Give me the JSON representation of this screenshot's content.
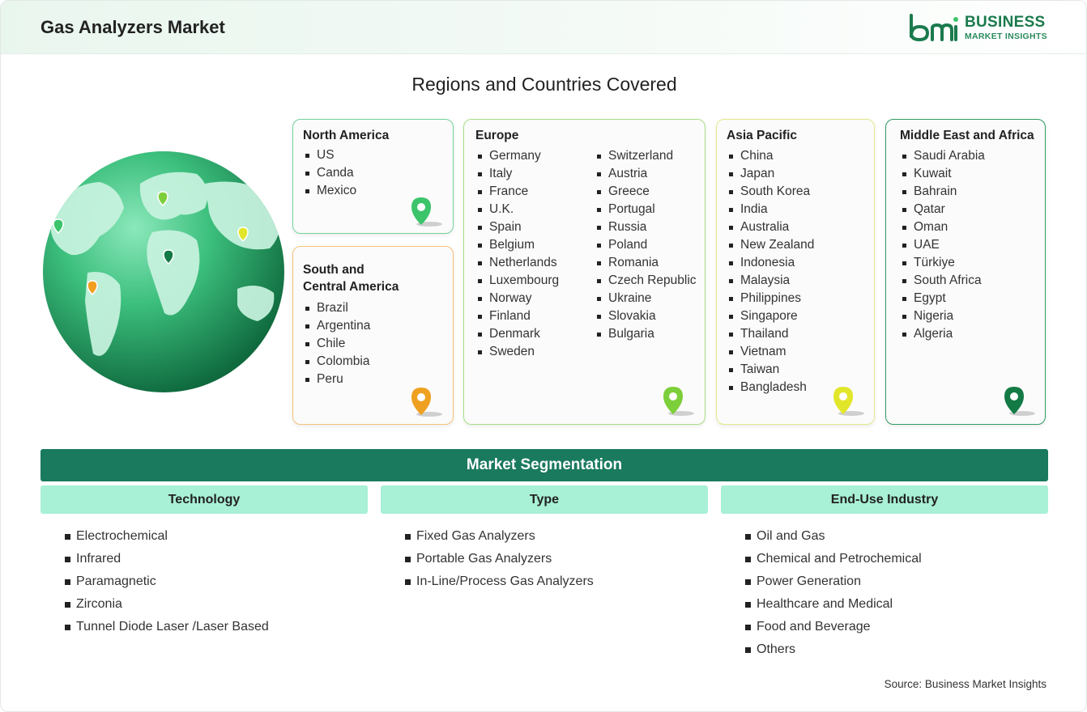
{
  "header": {
    "title": "Gas Analyzers Market"
  },
  "logo": {
    "line1": "BUSINESS",
    "line2": "MARKET INSIGHTS",
    "color": "#1b7a4d"
  },
  "regions_title": "Regions and Countries Covered",
  "regions": {
    "north_america": {
      "title": "North America",
      "items": [
        "US",
        "Canda",
        "Mexico"
      ],
      "pin_color": "#3cc46b"
    },
    "south_central_america": {
      "title_line1": "South and",
      "title_line2": "Central America",
      "items": [
        "Brazil",
        "Argentina",
        "Chile",
        "Colombia",
        "Peru"
      ],
      "pin_color": "#f0a020"
    },
    "europe": {
      "title": "Europe",
      "col1": [
        "Germany",
        "Italy",
        "France",
        "U.K.",
        "Spain",
        "Belgium",
        "Netherlands",
        "Luxembourg",
        "Norway",
        "Finland",
        "Denmark",
        "Sweden"
      ],
      "col2": [
        "Switzerland",
        "Austria",
        "Greece",
        "Portugal",
        "Russia",
        "Poland",
        "Romania",
        "Czech Republic",
        "Ukraine",
        "Slovakia",
        "Bulgaria"
      ],
      "pin_color": "#7ccf3a"
    },
    "asia_pacific": {
      "title": "Asia Pacific",
      "items": [
        "China",
        "Japan",
        "South Korea",
        "India",
        "Australia",
        "New Zealand",
        "Indonesia",
        "Malaysia",
        "Philippines",
        "Singapore",
        "Thailand",
        "Vietnam",
        "Taiwan",
        "Bangladesh"
      ],
      "pin_color": "#e2e62a"
    },
    "mea": {
      "title": "Middle East and Africa",
      "items": [
        "Saudi Arabia",
        "Kuwait",
        "Bahrain",
        "Qatar",
        "Oman",
        "UAE",
        "Türkiye",
        "South Africa",
        "Egypt",
        "Nigeria",
        "Algeria"
      ],
      "pin_color": "#137a45"
    }
  },
  "segmentation": {
    "title": "Market Segmentation",
    "columns": [
      {
        "header": "Technology",
        "items": [
          "Electrochemical",
          "Infrared",
          "Paramagnetic",
          "Zirconia",
          "Tunnel Diode Laser /Laser Based"
        ]
      },
      {
        "header": "Type",
        "items": [
          "Fixed Gas Analyzers",
          "Portable Gas Analyzers",
          "In-Line/Process Gas Analyzers"
        ]
      },
      {
        "header": "End-Use Industry",
        "items": [
          "Oil and Gas",
          "Chemical and Petrochemical",
          "Power Generation",
          "Healthcare and Medical",
          "Food and Beverage",
          "Others"
        ]
      }
    ]
  },
  "source": "Source: Business Market Insights",
  "colors": {
    "banner": "#1a7a5e",
    "subheader": "#a8f0d6",
    "globe_dark": "#137a45",
    "globe_light": "#5fd39a"
  }
}
